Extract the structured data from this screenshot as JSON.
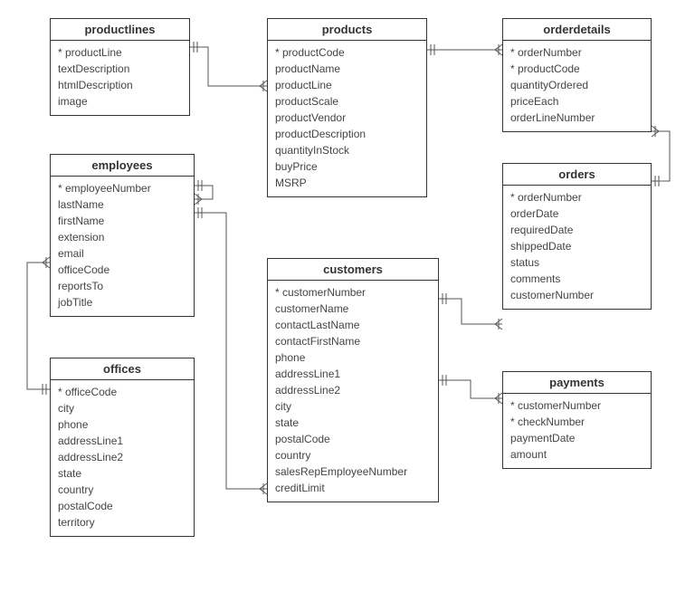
{
  "entities": {
    "productlines": {
      "title": "productlines",
      "fields": [
        {
          "name": "productLine",
          "pk": true
        },
        {
          "name": "textDescription",
          "pk": false
        },
        {
          "name": "htmlDescription",
          "pk": false
        },
        {
          "name": "image",
          "pk": false
        }
      ]
    },
    "products": {
      "title": "products",
      "fields": [
        {
          "name": "productCode",
          "pk": true
        },
        {
          "name": "productName",
          "pk": false
        },
        {
          "name": "productLine",
          "pk": false
        },
        {
          "name": "productScale",
          "pk": false
        },
        {
          "name": "productVendor",
          "pk": false
        },
        {
          "name": "productDescription",
          "pk": false
        },
        {
          "name": "quantityInStock",
          "pk": false
        },
        {
          "name": "buyPrice",
          "pk": false
        },
        {
          "name": "MSRP",
          "pk": false
        }
      ]
    },
    "orderdetails": {
      "title": "orderdetails",
      "fields": [
        {
          "name": "orderNumber",
          "pk": true
        },
        {
          "name": "productCode",
          "pk": true
        },
        {
          "name": "quantityOrdered",
          "pk": false
        },
        {
          "name": "priceEach",
          "pk": false
        },
        {
          "name": "orderLineNumber",
          "pk": false
        }
      ]
    },
    "employees": {
      "title": "employees",
      "fields": [
        {
          "name": "employeeNumber",
          "pk": true
        },
        {
          "name": "lastName",
          "pk": false
        },
        {
          "name": "firstName",
          "pk": false
        },
        {
          "name": "extension",
          "pk": false
        },
        {
          "name": "email",
          "pk": false
        },
        {
          "name": "officeCode",
          "pk": false
        },
        {
          "name": "reportsTo",
          "pk": false
        },
        {
          "name": "jobTitle",
          "pk": false
        }
      ]
    },
    "orders": {
      "title": "orders",
      "fields": [
        {
          "name": "orderNumber",
          "pk": true
        },
        {
          "name": "orderDate",
          "pk": false
        },
        {
          "name": "requiredDate",
          "pk": false
        },
        {
          "name": "shippedDate",
          "pk": false
        },
        {
          "name": "status",
          "pk": false
        },
        {
          "name": "comments",
          "pk": false
        },
        {
          "name": "customerNumber",
          "pk": false
        }
      ]
    },
    "offices": {
      "title": "offices",
      "fields": [
        {
          "name": "officeCode",
          "pk": true
        },
        {
          "name": "city",
          "pk": false
        },
        {
          "name": "phone",
          "pk": false
        },
        {
          "name": "addressLine1",
          "pk": false
        },
        {
          "name": "addressLine2",
          "pk": false
        },
        {
          "name": "state",
          "pk": false
        },
        {
          "name": "country",
          "pk": false
        },
        {
          "name": "postalCode",
          "pk": false
        },
        {
          "name": "territory",
          "pk": false
        }
      ]
    },
    "customers": {
      "title": "customers",
      "fields": [
        {
          "name": "customerNumber",
          "pk": true
        },
        {
          "name": "customerName",
          "pk": false
        },
        {
          "name": "contactLastName",
          "pk": false
        },
        {
          "name": "contactFirstName",
          "pk": false
        },
        {
          "name": "phone",
          "pk": false
        },
        {
          "name": "addressLine1",
          "pk": false
        },
        {
          "name": "addressLine2",
          "pk": false
        },
        {
          "name": "city",
          "pk": false
        },
        {
          "name": "state",
          "pk": false
        },
        {
          "name": "postalCode",
          "pk": false
        },
        {
          "name": "country",
          "pk": false
        },
        {
          "name": "salesRepEmployeeNumber",
          "pk": false
        },
        {
          "name": "creditLimit",
          "pk": false
        }
      ]
    },
    "payments": {
      "title": "payments",
      "fields": [
        {
          "name": "customerNumber",
          "pk": true
        },
        {
          "name": "checkNumber",
          "pk": true
        },
        {
          "name": "paymentDate",
          "pk": false
        },
        {
          "name": "amount",
          "pk": false
        }
      ]
    }
  },
  "relationships": [
    {
      "from": "productlines",
      "to": "products",
      "fromCard": "one",
      "toCard": "many"
    },
    {
      "from": "products",
      "to": "orderdetails",
      "fromCard": "one",
      "toCard": "many"
    },
    {
      "from": "orders",
      "to": "orderdetails",
      "fromCard": "one",
      "toCard": "many"
    },
    {
      "from": "customers",
      "to": "orders",
      "fromCard": "one",
      "toCard": "many"
    },
    {
      "from": "customers",
      "to": "payments",
      "fromCard": "one",
      "toCard": "many"
    },
    {
      "from": "employees",
      "to": "customers",
      "fromCard": "one",
      "toCard": "many"
    },
    {
      "from": "employees",
      "to": "employees",
      "fromCard": "one",
      "toCard": "many"
    },
    {
      "from": "offices",
      "to": "employees",
      "fromCard": "one",
      "toCard": "many"
    }
  ]
}
